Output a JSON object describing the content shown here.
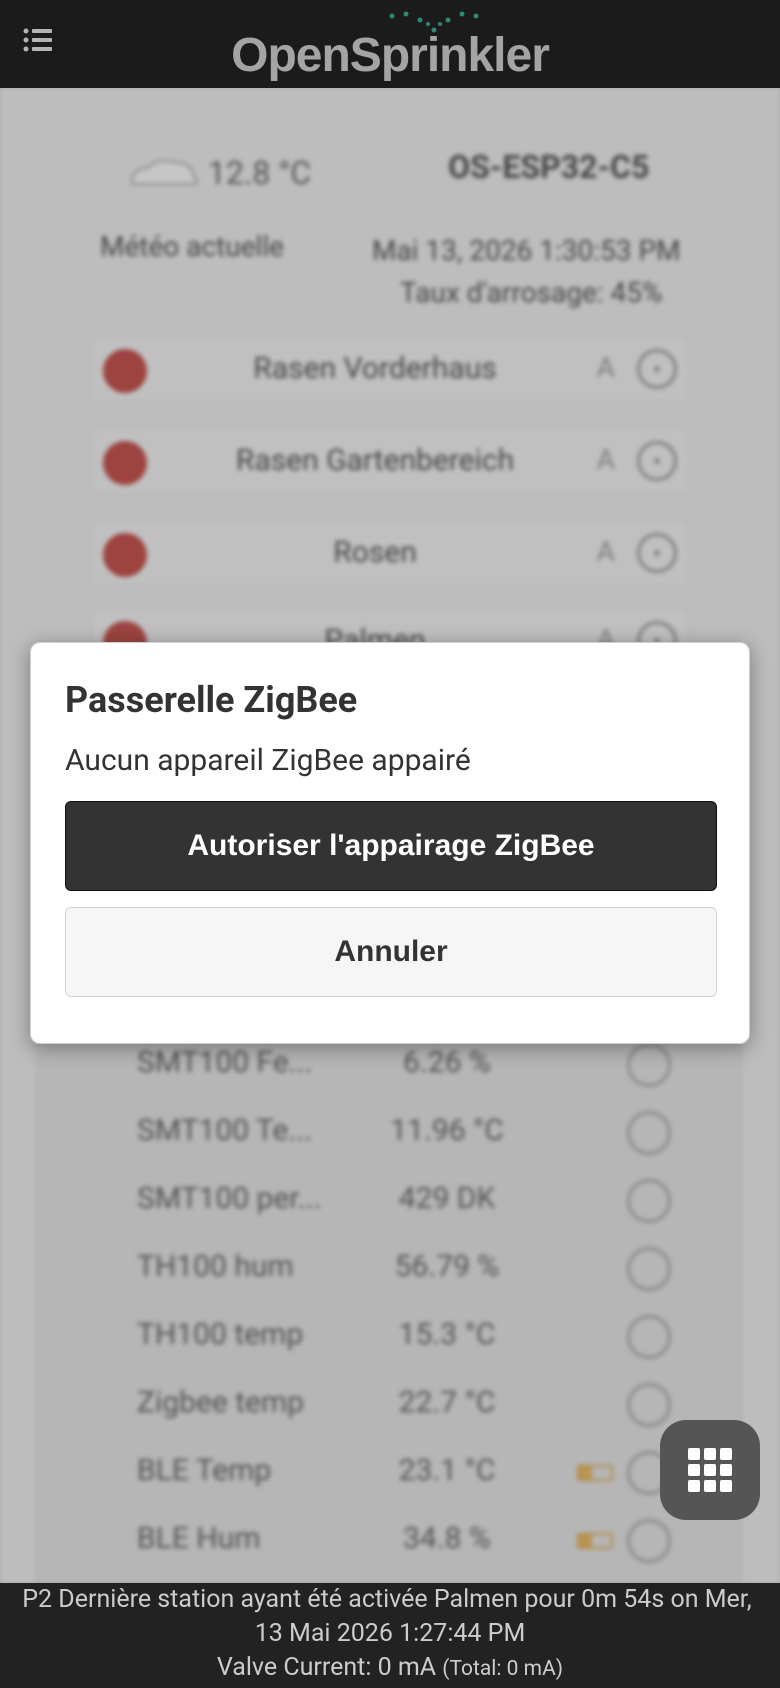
{
  "header": {
    "brand": "OpenSprinkler",
    "menu_icon": "menu-list-icon"
  },
  "status": {
    "temperature": "12.8 °C",
    "device_name": "OS-ESP32-C5",
    "weather_label": "Météo actuelle",
    "datetime": "Mai 13, 2026 1:30:53 PM",
    "watering_rate": "Taux d'arrosage: 45%"
  },
  "stations": [
    {
      "name": "Rasen Vorderhaus",
      "mode": "A"
    },
    {
      "name": "Rasen Gartenbereich",
      "mode": "A"
    },
    {
      "name": "Rosen",
      "mode": "A"
    },
    {
      "name": "Palmen",
      "mode": "A"
    }
  ],
  "sensors": [
    {
      "name": "SMT100 Fe...",
      "value": "6.26",
      "unit": "%"
    },
    {
      "name": "SMT100 Te...",
      "value": "11.96",
      "unit": "°C"
    },
    {
      "name": "SMT100 per...",
      "value": "429",
      "unit": "DK"
    },
    {
      "name": "TH100 hum",
      "value": "56.79",
      "unit": "%"
    },
    {
      "name": "TH100 temp",
      "value": "15.3",
      "unit": "°C"
    },
    {
      "name": "Zigbee temp",
      "value": "22.7",
      "unit": "°C"
    },
    {
      "name": "BLE Temp",
      "value": "23.1",
      "unit": "°C"
    },
    {
      "name": "BLE Hum",
      "value": "34.8",
      "unit": "%"
    }
  ],
  "dialog": {
    "title": "Passerelle ZigBee",
    "message": "Aucun appareil ZigBee appairé",
    "primary_label": "Autoriser l'appairage ZigBee",
    "secondary_label": "Annuler"
  },
  "footer": {
    "last_run_line1": "P2 Dernière station ayant été activée Palmen pour 0m 54s on Mer,",
    "last_run_line2": "13 Mai 2026 1:27:44 PM",
    "valve_current": "Valve Current: 0 mA",
    "valve_total": "(Total: 0 mA)"
  },
  "colors": {
    "header_bg": "#222222",
    "station_off": "#c0534f",
    "primary_button": "#333333",
    "battery": "#d6a955"
  }
}
